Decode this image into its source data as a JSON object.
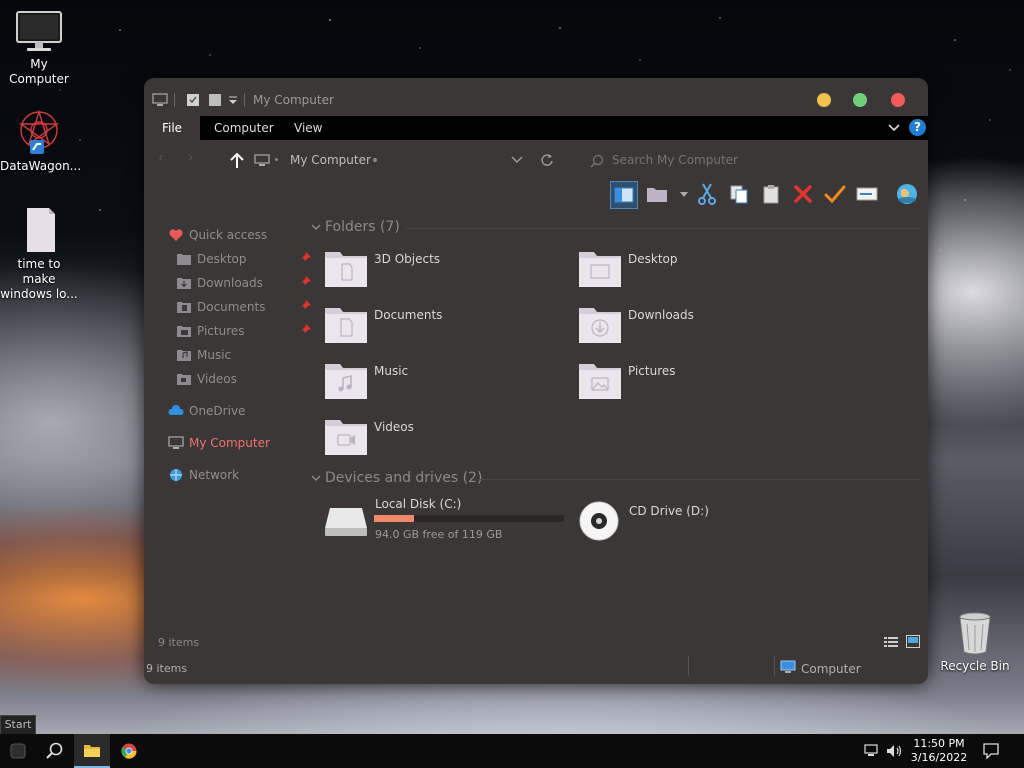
{
  "desktop": {
    "icons": [
      {
        "label": "My Computer"
      },
      {
        "label": "DataWagon..."
      },
      {
        "label": "time to make windows lo..."
      },
      {
        "label": "Recycle Bin"
      }
    ]
  },
  "window": {
    "title": "My Computer",
    "colors": {
      "minimize": "#f2c14e",
      "maximize": "#6fd07a",
      "close": "#f05a5a",
      "accent_red": "#f07070",
      "drive_bar": "#f08a6a"
    },
    "ribbon": {
      "tabs": [
        "File",
        "Computer",
        "View"
      ]
    },
    "address": {
      "location": "My Computer",
      "search_placeholder": "Search My Computer"
    },
    "sidebar": {
      "quick_access": "Quick access",
      "quick_items": [
        "Desktop",
        "Downloads",
        "Documents",
        "Pictures",
        "Music",
        "Videos"
      ],
      "onedrive": "OneDrive",
      "my_computer": "My Computer",
      "network": "Network"
    },
    "folders_header": "Folders (7)",
    "folders": [
      "3D Objects",
      "Desktop",
      "Documents",
      "Downloads",
      "Music",
      "Pictures",
      "Videos"
    ],
    "drives_header": "Devices and drives (2)",
    "drives": [
      {
        "name": "Local Disk (C:)",
        "free_text": "94.0 GB free of 119 GB",
        "used_fraction": 0.21
      },
      {
        "name": "CD Drive (D:)"
      }
    ],
    "status_items": "9 items",
    "statusbar": {
      "left": "9 items",
      "right": "Computer"
    }
  },
  "taskbar": {
    "start_tip": "Start",
    "time": "11:50 PM",
    "date": "3/16/2022"
  }
}
